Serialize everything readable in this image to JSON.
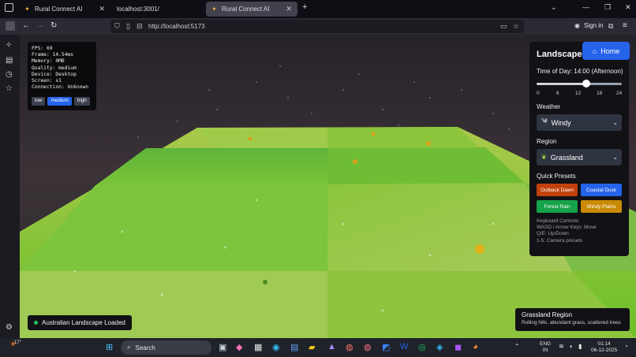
{
  "browser": {
    "tabs": [
      {
        "label": "Rural Connect AI",
        "active": false
      },
      {
        "label": "localhost:3001/",
        "active": false
      },
      {
        "label": "Rural Connect AI",
        "active": true
      }
    ],
    "new_tab": "+",
    "url": "http://localhost:5173",
    "sign_in": "Sign in"
  },
  "perf": {
    "lines": [
      "FPS: 69",
      "Frame: 14.54ms",
      "Memory: 0MB",
      "Quality: medium",
      "Device: Desktop",
      "Screen: x1",
      "Connection: Unknown"
    ],
    "quality_buttons": [
      "low",
      "medium",
      "high"
    ],
    "selected_quality": "medium"
  },
  "panel": {
    "title": "Landscape C",
    "home_label": "Home",
    "time_label": "Time of Day: 14:00 (Afternoon)",
    "time_value": 14,
    "time_max": 24,
    "ticks": [
      "0",
      "6",
      "12",
      "18",
      "24"
    ],
    "weather_label": "Weather",
    "weather_value": "Windy",
    "region_label": "Region",
    "region_value": "Grassland",
    "presets_label": "Quick Presets",
    "presets": [
      {
        "label": "Outback Dawn",
        "color": "#c2410c"
      },
      {
        "label": "Coastal Dusk",
        "color": "#2563eb"
      },
      {
        "label": "Forest Rain",
        "color": "#16a34a"
      },
      {
        "label": "Windy Plains",
        "color": "#ca8a04"
      }
    ],
    "keyboard_title": "Keyboard Controls:",
    "keyboard_lines": [
      "WASD / Arrow Keys: Move",
      "Q/E: Up/Down",
      "1-5: Camera presets"
    ]
  },
  "toast": {
    "label": "Australian Landscape Loaded",
    "color": "#22c55e"
  },
  "region_card": {
    "title": "Grassland Region",
    "desc": "Rolling hills, abundant grass, scattered trees"
  },
  "taskbar": {
    "weather_temp": "17°",
    "search_label": "Search",
    "lang_top": "ENG",
    "lang_bottom": "IN",
    "time": "01:14",
    "date": "06-12-2025"
  }
}
